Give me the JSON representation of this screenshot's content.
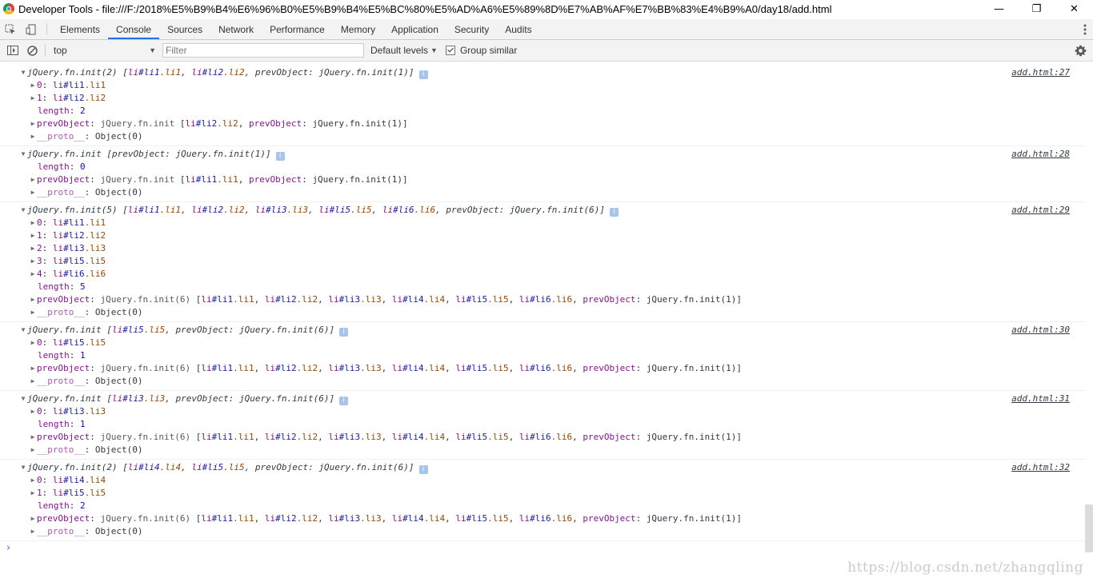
{
  "window": {
    "title": "Developer Tools - file:///F:/2018%E5%B9%B4%E6%96%B0%E5%B9%B4%E5%BC%80%E5%AD%A6%E5%89%8D%E7%AB%AF%E7%BB%83%E4%B9%A0/day18/add.html",
    "minimize": "—",
    "restore": "❐",
    "close": "✕"
  },
  "tabs": [
    "Elements",
    "Console",
    "Sources",
    "Network",
    "Performance",
    "Memory",
    "Application",
    "Security",
    "Audits"
  ],
  "active_tab": "Console",
  "toolbar": {
    "context": "top",
    "filter_placeholder": "Filter",
    "levels": "Default levels",
    "group_similar": "Group similar"
  },
  "messages": [
    {
      "header": "jQuery.fn.init(2) [li#li1.li1, li#li2.li2, prevObject: jQuery.fn.init(1)]",
      "source": "add.html:27",
      "lines": [
        {
          "key": "0",
          "value": "li#li1.li1",
          "expandable": true
        },
        {
          "key": "1",
          "value": "li#li2.li2",
          "expandable": true
        },
        {
          "key": "length",
          "value": "2",
          "expandable": false
        },
        {
          "key": "prevObject",
          "value": "jQuery.fn.init [li#li2.li2, prevObject: jQuery.fn.init(1)]",
          "expandable": true
        },
        {
          "key": "__proto__",
          "value": "Object(0)",
          "expandable": true
        }
      ]
    },
    {
      "header": "jQuery.fn.init [prevObject: jQuery.fn.init(1)]",
      "source": "add.html:28",
      "lines": [
        {
          "key": "length",
          "value": "0",
          "expandable": false
        },
        {
          "key": "prevObject",
          "value": "jQuery.fn.init [li#li1.li1, prevObject: jQuery.fn.init(1)]",
          "expandable": true
        },
        {
          "key": "__proto__",
          "value": "Object(0)",
          "expandable": true
        }
      ]
    },
    {
      "header": "jQuery.fn.init(5) [li#li1.li1, li#li2.li2, li#li3.li3, li#li5.li5, li#li6.li6, prevObject: jQuery.fn.init(6)]",
      "source": "add.html:29",
      "lines": [
        {
          "key": "0",
          "value": "li#li1.li1",
          "expandable": true
        },
        {
          "key": "1",
          "value": "li#li2.li2",
          "expandable": true
        },
        {
          "key": "2",
          "value": "li#li3.li3",
          "expandable": true
        },
        {
          "key": "3",
          "value": "li#li5.li5",
          "expandable": true
        },
        {
          "key": "4",
          "value": "li#li6.li6",
          "expandable": true
        },
        {
          "key": "length",
          "value": "5",
          "expandable": false
        },
        {
          "key": "prevObject",
          "value": "jQuery.fn.init(6) [li#li1.li1, li#li2.li2, li#li3.li3, li#li4.li4, li#li5.li5, li#li6.li6, prevObject: jQuery.fn.init(1)]",
          "expandable": true
        },
        {
          "key": "__proto__",
          "value": "Object(0)",
          "expandable": true
        }
      ]
    },
    {
      "header": "jQuery.fn.init [li#li5.li5, prevObject: jQuery.fn.init(6)]",
      "source": "add.html:30",
      "lines": [
        {
          "key": "0",
          "value": "li#li5.li5",
          "expandable": true
        },
        {
          "key": "length",
          "value": "1",
          "expandable": false
        },
        {
          "key": "prevObject",
          "value": "jQuery.fn.init(6) [li#li1.li1, li#li2.li2, li#li3.li3, li#li4.li4, li#li5.li5, li#li6.li6, prevObject: jQuery.fn.init(1)]",
          "expandable": true
        },
        {
          "key": "__proto__",
          "value": "Object(0)",
          "expandable": true
        }
      ]
    },
    {
      "header": "jQuery.fn.init [li#li3.li3, prevObject: jQuery.fn.init(6)]",
      "source": "add.html:31",
      "lines": [
        {
          "key": "0",
          "value": "li#li3.li3",
          "expandable": true
        },
        {
          "key": "length",
          "value": "1",
          "expandable": false
        },
        {
          "key": "prevObject",
          "value": "jQuery.fn.init(6) [li#li1.li1, li#li2.li2, li#li3.li3, li#li4.li4, li#li5.li5, li#li6.li6, prevObject: jQuery.fn.init(1)]",
          "expandable": true
        },
        {
          "key": "__proto__",
          "value": "Object(0)",
          "expandable": true
        }
      ]
    },
    {
      "header": "jQuery.fn.init(2) [li#li4.li4, li#li5.li5, prevObject: jQuery.fn.init(6)]",
      "source": "add.html:32",
      "lines": [
        {
          "key": "0",
          "value": "li#li4.li4",
          "expandable": true
        },
        {
          "key": "1",
          "value": "li#li5.li5",
          "expandable": true
        },
        {
          "key": "length",
          "value": "2",
          "expandable": false
        },
        {
          "key": "prevObject",
          "value": "jQuery.fn.init(6) [li#li1.li1, li#li2.li2, li#li3.li3, li#li4.li4, li#li5.li5, li#li6.li6, prevObject: jQuery.fn.init(1)]",
          "expandable": true
        },
        {
          "key": "__proto__",
          "value": "Object(0)",
          "expandable": true
        }
      ]
    }
  ],
  "prompt": "›",
  "watermark": "https://blog.csdn.net/zhangqling",
  "icons": {
    "inspect": "inspect-element-icon",
    "device": "device-toolbar-icon",
    "sidebar": "console-sidebar-icon",
    "clear": "clear-console-icon",
    "settings": "gear-icon",
    "menu": "kebab-menu-icon",
    "info": "info-icon"
  },
  "colors": {
    "accent": "#1a73e8",
    "key": "#881391",
    "selector_id": "#1a1aa6",
    "selector_class": "#994500",
    "number": "#1c00cf",
    "prompt": "#367cf1"
  }
}
